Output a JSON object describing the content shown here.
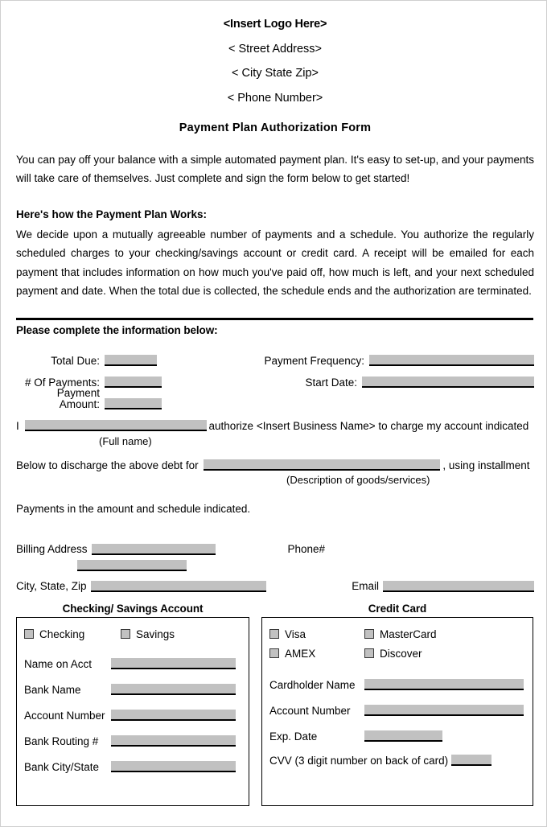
{
  "header": {
    "logo": "<Insert Logo Here>",
    "street": "< Street Address>",
    "city_state_zip": "< City State Zip>",
    "phone": "< Phone Number>",
    "title": "Payment Plan Authorization Form"
  },
  "intro": {
    "paragraph": "You can pay off your balance with a simple automated payment plan.  It's easy to set-up, and your payments will take care of themselves.  Just complete and sign the form below to get started!"
  },
  "how_it_works": {
    "heading": "Here's how the Payment Plan Works:",
    "paragraph": "We decide upon a mutually agreeable number of payments and a schedule.  You authorize the regularly scheduled charges to your checking/savings account or credit card.  A receipt will be emailed for each payment that includes information on how much you've paid off, how much is left, and your next scheduled payment and date.  When the total due is collected, the schedule ends and the authorization are terminated."
  },
  "complete_section": {
    "heading": "Please complete the information below:",
    "fields": {
      "total_due_label": "Total Due:",
      "total_due_value": "",
      "payment_frequency_label": "Payment Frequency:",
      "payment_frequency_value": "",
      "num_payments_label": "# Of Payments:",
      "num_payments_value": "",
      "start_date_label": "Start Date:",
      "start_date_value": "",
      "payment_amount_label": "Payment Amount:",
      "payment_amount_value": ""
    }
  },
  "authorization": {
    "prefix": "I",
    "full_name_value": "",
    "suffix": "authorize <Insert Business Name> to charge my account indicated",
    "full_name_caption": "(Full name)",
    "below_prefix": "Below to discharge the above debt for",
    "description_value": "",
    "below_suffix": ", using installment",
    "description_caption": "(Description of goods/services)",
    "payments_line": "Payments in the amount and schedule indicated."
  },
  "billing": {
    "billing_address_label": "Billing Address",
    "billing_address_value": "",
    "billing_address_line2_value": "",
    "phone_label": "Phone#",
    "city_state_zip_label": "City, State, Zip",
    "city_state_zip_value": "",
    "email_label": "Email",
    "email_value": ""
  },
  "checking_savings": {
    "title": "Checking/ Savings Account",
    "checkboxes": [
      {
        "label": "Checking",
        "checked": false
      },
      {
        "label": "Savings",
        "checked": false
      }
    ],
    "fields": [
      {
        "label": "Name on Acct",
        "value": ""
      },
      {
        "label": "Bank Name",
        "value": ""
      },
      {
        "label": "Account Number",
        "value": ""
      },
      {
        "label": "Bank Routing #",
        "value": ""
      },
      {
        "label": "Bank City/State",
        "value": ""
      }
    ]
  },
  "credit_card": {
    "title": "Credit Card",
    "checkboxes": [
      {
        "label": "Visa",
        "checked": false
      },
      {
        "label": "MasterCard",
        "checked": false
      },
      {
        "label": "AMEX",
        "checked": false
      },
      {
        "label": "Discover",
        "checked": false
      }
    ],
    "fields": [
      {
        "label": "Cardholder Name",
        "value": ""
      },
      {
        "label": "Account Number",
        "value": ""
      },
      {
        "label": "Exp. Date",
        "value": ""
      }
    ],
    "cvv_label": "CVV (3 digit number on back of card)",
    "cvv_value": ""
  },
  "colors": {
    "field_fill": "#c1c1c1",
    "rule": "#000000",
    "page_border": "#cfcfcf"
  }
}
